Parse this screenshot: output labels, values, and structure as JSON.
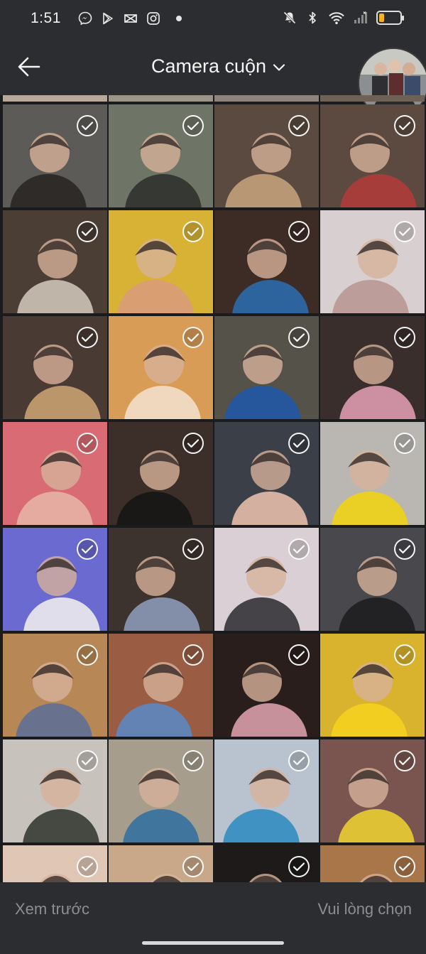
{
  "status_bar": {
    "time": "1:51",
    "left_icons": [
      "messenger-icon",
      "play-store-icon",
      "capcut-icon",
      "instagram-icon",
      "notification-dot-icon"
    ],
    "right_icons": [
      "mute-icon",
      "bluetooth-icon",
      "wifi-icon",
      "signal-icon",
      "battery-icon"
    ],
    "battery_level": 0.25
  },
  "header": {
    "title": "Camera cuộn",
    "back_icon": "arrow-left-icon",
    "dropdown_icon": "chevron-down-icon"
  },
  "gallery": {
    "check_icon": "check-circle-icon",
    "photos": [
      {
        "id": "r0c0",
        "bg": "#5d5b57",
        "fg": "#262321"
      },
      {
        "id": "r0c1",
        "bg": "#6f7566",
        "fg": "#2d2e2b"
      },
      {
        "id": "r0c2",
        "bg": "#5a4a3f",
        "fg": "#c9a57e"
      },
      {
        "id": "r0c3",
        "bg": "#5c4a40",
        "fg": "#b33b3b"
      },
      {
        "id": "r1c0",
        "bg": "#4b3e35",
        "fg": "#d4cbbd"
      },
      {
        "id": "r1c1",
        "bg": "#d8b235",
        "fg": "#d99a7c"
      },
      {
        "id": "r1c2",
        "bg": "#3d2b26",
        "fg": "#2a6fb3"
      },
      {
        "id": "r1c3",
        "bg": "#d7cfd0",
        "fg": "#b9948f"
      },
      {
        "id": "r2c0",
        "bg": "#4a3a34",
        "fg": "#d0a775"
      },
      {
        "id": "r2c1",
        "bg": "#d99c56",
        "fg": "#f2e3cf"
      },
      {
        "id": "r2c2",
        "bg": "#55524a",
        "fg": "#1f57a9"
      },
      {
        "id": "r2c3",
        "bg": "#3a2e2d",
        "fg": "#e7a1b7"
      },
      {
        "id": "r3c0",
        "bg": "#d86b73",
        "fg": "#e9b6a8"
      },
      {
        "id": "r3c1",
        "bg": "#3c2f2a",
        "fg": "#141414"
      },
      {
        "id": "r3c2",
        "bg": "#3b3f47",
        "fg": "#f0c4b0"
      },
      {
        "id": "r3c3",
        "bg": "#bab7b2",
        "fg": "#f2d40c"
      },
      {
        "id": "r4c0",
        "bg": "#6b6ad0",
        "fg": "#f3f2ee"
      },
      {
        "id": "r4c1",
        "bg": "#3d332e",
        "fg": "#8fa0be"
      },
      {
        "id": "r4c2",
        "bg": "#d9cfd4",
        "fg": "#2a2a2e"
      },
      {
        "id": "r4c3",
        "bg": "#48484d",
        "fg": "#1c1c1e"
      },
      {
        "id": "r5c0",
        "bg": "#b78855",
        "fg": "#5a6f9a"
      },
      {
        "id": "r5c1",
        "bg": "#9a5d43",
        "fg": "#5889c7"
      },
      {
        "id": "r5c2",
        "bg": "#2a1e1d",
        "fg": "#e3a6b3"
      },
      {
        "id": "r5c3",
        "bg": "#d9b32e",
        "fg": "#f4d21c"
      },
      {
        "id": "r6c0",
        "bg": "#c8c2bd",
        "fg": "#2f332d"
      },
      {
        "id": "r6c1",
        "bg": "#a69d8c",
        "fg": "#2e6fa0"
      },
      {
        "id": "r6c2",
        "bg": "#b9c2cf",
        "fg": "#2a8ac0"
      },
      {
        "id": "r6c3",
        "bg": "#7a5550",
        "fg": "#f0d530"
      },
      {
        "id": "r7c0",
        "bg": "#e0c6b4",
        "fg": "#c4455c"
      },
      {
        "id": "r7c1",
        "bg": "#c9a889",
        "fg": "#f0e2d2"
      },
      {
        "id": "r7c2",
        "bg": "#1e1a1a",
        "fg": "#d0b2a2"
      },
      {
        "id": "r7c3",
        "bg": "#a9764a",
        "fg": "#c98b3c"
      }
    ]
  },
  "bottom_bar": {
    "preview_label": "Xem trước",
    "choose_label": "Vui lòng chọn"
  }
}
